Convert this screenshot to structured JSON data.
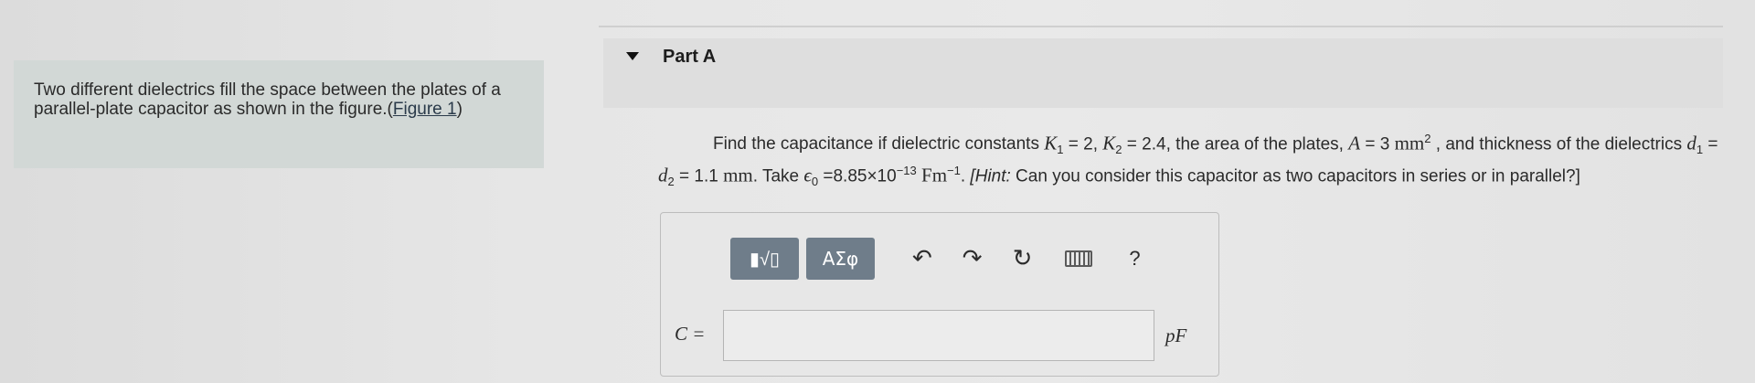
{
  "left_panel": {
    "description": "Two different dielectrics fill the space between the plates of a parallel-plate capacitor as shown in the figure.(",
    "figure_link": "Figure 1",
    "close_paren": ")"
  },
  "part": {
    "title": "Part A"
  },
  "question": {
    "p1": "Find the capacitance if dielectric constants",
    "k1": "K",
    "k1_sub": "1",
    "k1_val": " = 2, ",
    "k2": "K",
    "k2_sub": "2",
    "k2_val": " = 2.4",
    "p2": ", the area of the plates, ",
    "area_var": "A",
    "area_val": " = 3 ",
    "area_unit": "mm",
    "area_exp": "2",
    "p3": " , and thickness of the dielectrics ",
    "d1": "d",
    "d1_sub": "1",
    "eq": " = ",
    "d2": "d",
    "d2_sub": "2",
    "d_val": " = 1.1 ",
    "d_unit": "mm",
    "p4": ". Take ",
    "eps": "ϵ",
    "eps_sub": "0",
    "eps_val": " =8.85×10",
    "eps_exp": "−13",
    "eps_unit": " Fm",
    "eps_unit_exp": "−1",
    "p5": ". ",
    "hint_label": "[Hint:",
    "hint_text": " Can you consider this capacitor as two capacitors in series or in parallel?]"
  },
  "toolbar": {
    "templates_glyph": "▮√▯",
    "greek_label": "ΑΣφ",
    "undo_glyph": "↶",
    "redo_glyph": "↷",
    "reset_glyph": "↻",
    "help_glyph": "?"
  },
  "answer": {
    "label": "C =",
    "value": "",
    "unit": "pF"
  }
}
